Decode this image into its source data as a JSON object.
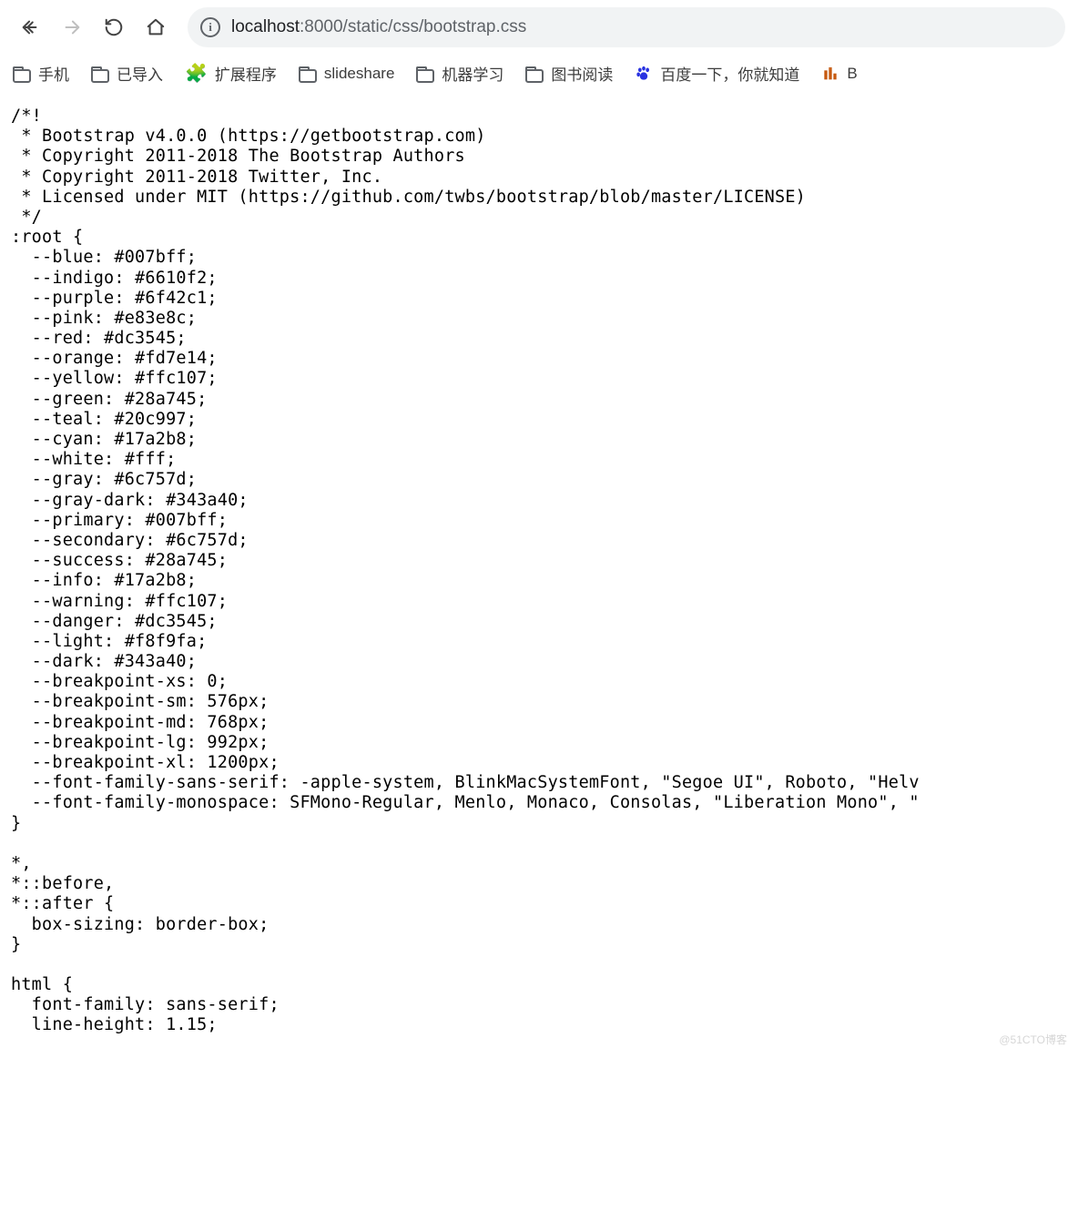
{
  "url": {
    "host": "localhost",
    "port_path": ":8000/static/css/bootstrap.css"
  },
  "bookmarks": [
    {
      "label": "手机",
      "icon": "folder"
    },
    {
      "label": "已导入",
      "icon": "folder"
    },
    {
      "label": "扩展程序",
      "icon": "puzzle"
    },
    {
      "label": "slideshare",
      "icon": "folder"
    },
    {
      "label": "机器学习",
      "icon": "folder"
    },
    {
      "label": "图书阅读",
      "icon": "folder"
    },
    {
      "label": "百度一下，你就知道",
      "icon": "baidu"
    },
    {
      "label": "B",
      "icon": "city"
    }
  ],
  "file_content": "/*!\n * Bootstrap v4.0.0 (https://getbootstrap.com)\n * Copyright 2011-2018 The Bootstrap Authors\n * Copyright 2011-2018 Twitter, Inc.\n * Licensed under MIT (https://github.com/twbs/bootstrap/blob/master/LICENSE)\n */\n:root {\n  --blue: #007bff;\n  --indigo: #6610f2;\n  --purple: #6f42c1;\n  --pink: #e83e8c;\n  --red: #dc3545;\n  --orange: #fd7e14;\n  --yellow: #ffc107;\n  --green: #28a745;\n  --teal: #20c997;\n  --cyan: #17a2b8;\n  --white: #fff;\n  --gray: #6c757d;\n  --gray-dark: #343a40;\n  --primary: #007bff;\n  --secondary: #6c757d;\n  --success: #28a745;\n  --info: #17a2b8;\n  --warning: #ffc107;\n  --danger: #dc3545;\n  --light: #f8f9fa;\n  --dark: #343a40;\n  --breakpoint-xs: 0;\n  --breakpoint-sm: 576px;\n  --breakpoint-md: 768px;\n  --breakpoint-lg: 992px;\n  --breakpoint-xl: 1200px;\n  --font-family-sans-serif: -apple-system, BlinkMacSystemFont, \"Segoe UI\", Roboto, \"Helv\n  --font-family-monospace: SFMono-Regular, Menlo, Monaco, Consolas, \"Liberation Mono\", \"\n}\n\n*,\n*::before,\n*::after {\n  box-sizing: border-box;\n}\n\nhtml {\n  font-family: sans-serif;\n  line-height: 1.15;",
  "watermark": "@51CTO博客"
}
